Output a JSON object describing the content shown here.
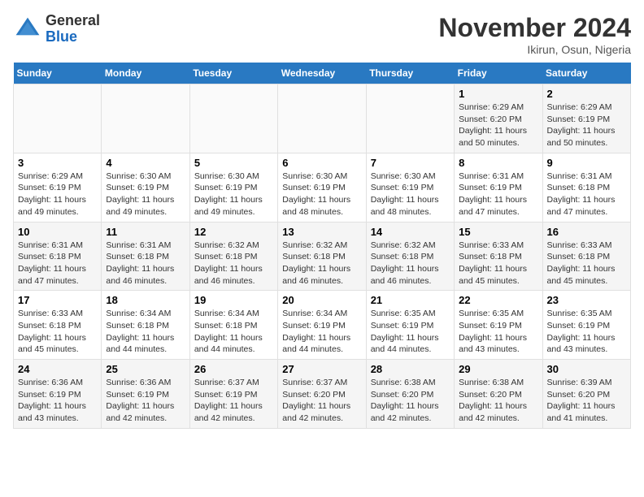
{
  "header": {
    "logo_line1": "General",
    "logo_line2": "Blue",
    "month": "November 2024",
    "location": "Ikirun, Osun, Nigeria"
  },
  "weekdays": [
    "Sunday",
    "Monday",
    "Tuesday",
    "Wednesday",
    "Thursday",
    "Friday",
    "Saturday"
  ],
  "weeks": [
    [
      {
        "day": "",
        "info": ""
      },
      {
        "day": "",
        "info": ""
      },
      {
        "day": "",
        "info": ""
      },
      {
        "day": "",
        "info": ""
      },
      {
        "day": "",
        "info": ""
      },
      {
        "day": "1",
        "info": "Sunrise: 6:29 AM\nSunset: 6:20 PM\nDaylight: 11 hours and 50 minutes."
      },
      {
        "day": "2",
        "info": "Sunrise: 6:29 AM\nSunset: 6:19 PM\nDaylight: 11 hours and 50 minutes."
      }
    ],
    [
      {
        "day": "3",
        "info": "Sunrise: 6:29 AM\nSunset: 6:19 PM\nDaylight: 11 hours and 49 minutes."
      },
      {
        "day": "4",
        "info": "Sunrise: 6:30 AM\nSunset: 6:19 PM\nDaylight: 11 hours and 49 minutes."
      },
      {
        "day": "5",
        "info": "Sunrise: 6:30 AM\nSunset: 6:19 PM\nDaylight: 11 hours and 49 minutes."
      },
      {
        "day": "6",
        "info": "Sunrise: 6:30 AM\nSunset: 6:19 PM\nDaylight: 11 hours and 48 minutes."
      },
      {
        "day": "7",
        "info": "Sunrise: 6:30 AM\nSunset: 6:19 PM\nDaylight: 11 hours and 48 minutes."
      },
      {
        "day": "8",
        "info": "Sunrise: 6:31 AM\nSunset: 6:19 PM\nDaylight: 11 hours and 47 minutes."
      },
      {
        "day": "9",
        "info": "Sunrise: 6:31 AM\nSunset: 6:18 PM\nDaylight: 11 hours and 47 minutes."
      }
    ],
    [
      {
        "day": "10",
        "info": "Sunrise: 6:31 AM\nSunset: 6:18 PM\nDaylight: 11 hours and 47 minutes."
      },
      {
        "day": "11",
        "info": "Sunrise: 6:31 AM\nSunset: 6:18 PM\nDaylight: 11 hours and 46 minutes."
      },
      {
        "day": "12",
        "info": "Sunrise: 6:32 AM\nSunset: 6:18 PM\nDaylight: 11 hours and 46 minutes."
      },
      {
        "day": "13",
        "info": "Sunrise: 6:32 AM\nSunset: 6:18 PM\nDaylight: 11 hours and 46 minutes."
      },
      {
        "day": "14",
        "info": "Sunrise: 6:32 AM\nSunset: 6:18 PM\nDaylight: 11 hours and 46 minutes."
      },
      {
        "day": "15",
        "info": "Sunrise: 6:33 AM\nSunset: 6:18 PM\nDaylight: 11 hours and 45 minutes."
      },
      {
        "day": "16",
        "info": "Sunrise: 6:33 AM\nSunset: 6:18 PM\nDaylight: 11 hours and 45 minutes."
      }
    ],
    [
      {
        "day": "17",
        "info": "Sunrise: 6:33 AM\nSunset: 6:18 PM\nDaylight: 11 hours and 45 minutes."
      },
      {
        "day": "18",
        "info": "Sunrise: 6:34 AM\nSunset: 6:18 PM\nDaylight: 11 hours and 44 minutes."
      },
      {
        "day": "19",
        "info": "Sunrise: 6:34 AM\nSunset: 6:18 PM\nDaylight: 11 hours and 44 minutes."
      },
      {
        "day": "20",
        "info": "Sunrise: 6:34 AM\nSunset: 6:19 PM\nDaylight: 11 hours and 44 minutes."
      },
      {
        "day": "21",
        "info": "Sunrise: 6:35 AM\nSunset: 6:19 PM\nDaylight: 11 hours and 44 minutes."
      },
      {
        "day": "22",
        "info": "Sunrise: 6:35 AM\nSunset: 6:19 PM\nDaylight: 11 hours and 43 minutes."
      },
      {
        "day": "23",
        "info": "Sunrise: 6:35 AM\nSunset: 6:19 PM\nDaylight: 11 hours and 43 minutes."
      }
    ],
    [
      {
        "day": "24",
        "info": "Sunrise: 6:36 AM\nSunset: 6:19 PM\nDaylight: 11 hours and 43 minutes."
      },
      {
        "day": "25",
        "info": "Sunrise: 6:36 AM\nSunset: 6:19 PM\nDaylight: 11 hours and 42 minutes."
      },
      {
        "day": "26",
        "info": "Sunrise: 6:37 AM\nSunset: 6:19 PM\nDaylight: 11 hours and 42 minutes."
      },
      {
        "day": "27",
        "info": "Sunrise: 6:37 AM\nSunset: 6:20 PM\nDaylight: 11 hours and 42 minutes."
      },
      {
        "day": "28",
        "info": "Sunrise: 6:38 AM\nSunset: 6:20 PM\nDaylight: 11 hours and 42 minutes."
      },
      {
        "day": "29",
        "info": "Sunrise: 6:38 AM\nSunset: 6:20 PM\nDaylight: 11 hours and 42 minutes."
      },
      {
        "day": "30",
        "info": "Sunrise: 6:39 AM\nSunset: 6:20 PM\nDaylight: 11 hours and 41 minutes."
      }
    ]
  ]
}
